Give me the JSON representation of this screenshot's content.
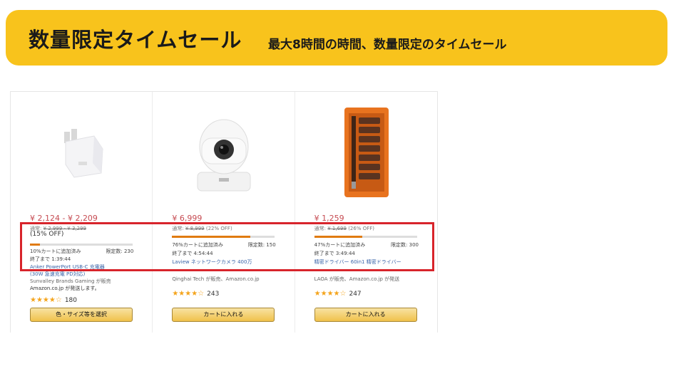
{
  "banner": {
    "title": "数量限定タイムセール",
    "subtitle": "最大8時間の時間、数量限定のタイムセール"
  },
  "products": [
    {
      "image_icon": "usb-charger-icon",
      "price": "¥ 2,124 - ¥ 2,209",
      "list_label": "通常:",
      "list_price": "¥ 2,999 - ¥ 3,299",
      "discount": "(15% OFF)",
      "claimed_fraction": 0.1,
      "claimed_text": "10%カートに追加済み",
      "limit_text": "限定数: 230",
      "ends_text": "終了まで 1:39:44",
      "name_line1": "Anker PowerPort USB-C 充電器",
      "name_line2": "(30W 急速充電 PD対応)",
      "seller_line1": "Sunvalley Brands Gaming が販売",
      "seller_line2": "Amazon.co.jp が発送します。",
      "stars": "★★★★☆",
      "rating_count": "180",
      "button_label": "色・サイズ等を選択"
    },
    {
      "image_icon": "security-camera-icon",
      "price": "¥ 6,999",
      "list_label": "通常:",
      "list_price": "¥ 8,999",
      "discount_inline": "(22% OFF)",
      "claimed_fraction": 0.76,
      "claimed_text": "76%カートに追加済み",
      "limit_text": "限定数: 150",
      "ends_text": "終了まで 4:54:44",
      "name_line1": "Laview ネットワークカメラ 400万",
      "name_line2": "",
      "seller_line1": "Qinghai Tech が販売、Amazon.co.jp",
      "seller_line2": "",
      "stars": "★★★★☆",
      "rating_count": "243",
      "button_label": "カートに入れる"
    },
    {
      "image_icon": "screwdriver-set-icon",
      "price": "¥ 1,259",
      "list_label": "通常:",
      "list_price": "¥ 1,699",
      "discount_inline": "(26% OFF)",
      "claimed_fraction": 0.47,
      "claimed_text": "47%カートに追加済み",
      "limit_text": "限定数: 300",
      "ends_text": "終了まで 3:49:44",
      "name_line1": "精密ドライバー 60in1 精密ドライバー",
      "name_line2": "",
      "seller_line1": "LAOA が販売、Amazon.co.jp が発送",
      "seller_line2": "",
      "stars": "★★★★☆",
      "rating_count": "247",
      "button_label": "カートに入れる"
    }
  ],
  "colors": {
    "banner_bg": "#f8c31c",
    "highlight": "#d8242b",
    "price": "#c64b52",
    "progress": "#e07b10"
  }
}
